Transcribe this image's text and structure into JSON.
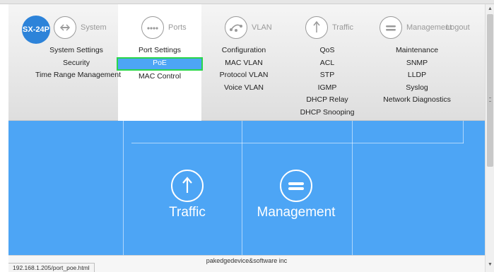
{
  "logo": "SX-24P",
  "nav": {
    "system": "System",
    "ports": "Ports",
    "vlan": "VLAN",
    "traffic": "Traffic",
    "management": "Management",
    "logout": "Logout"
  },
  "columns": {
    "system": [
      "System Settings",
      "Security",
      "Time Range Management"
    ],
    "ports": [
      "Port Settings",
      "PoE",
      "MAC Control"
    ],
    "vlan": [
      "Configuration",
      "MAC VLAN",
      "Protocol VLAN",
      "Voice VLAN"
    ],
    "traffic": [
      "QoS",
      "ACL",
      "STP",
      "IGMP",
      "DHCP Relay",
      "DHCP Snooping"
    ],
    "management": [
      "Maintenance",
      "SNMP",
      "LLDP",
      "Syslog",
      "Network Diagnostics"
    ]
  },
  "tiles": {
    "traffic": "Traffic",
    "management": "Management"
  },
  "footer": "pakedgedevice&software inc",
  "status_url": "192.168.1.205/port_poe.html",
  "colors": {
    "accent_blue": "#4da5f5",
    "logo_blue": "#2d83d9",
    "highlight_border": "#29d64a"
  }
}
